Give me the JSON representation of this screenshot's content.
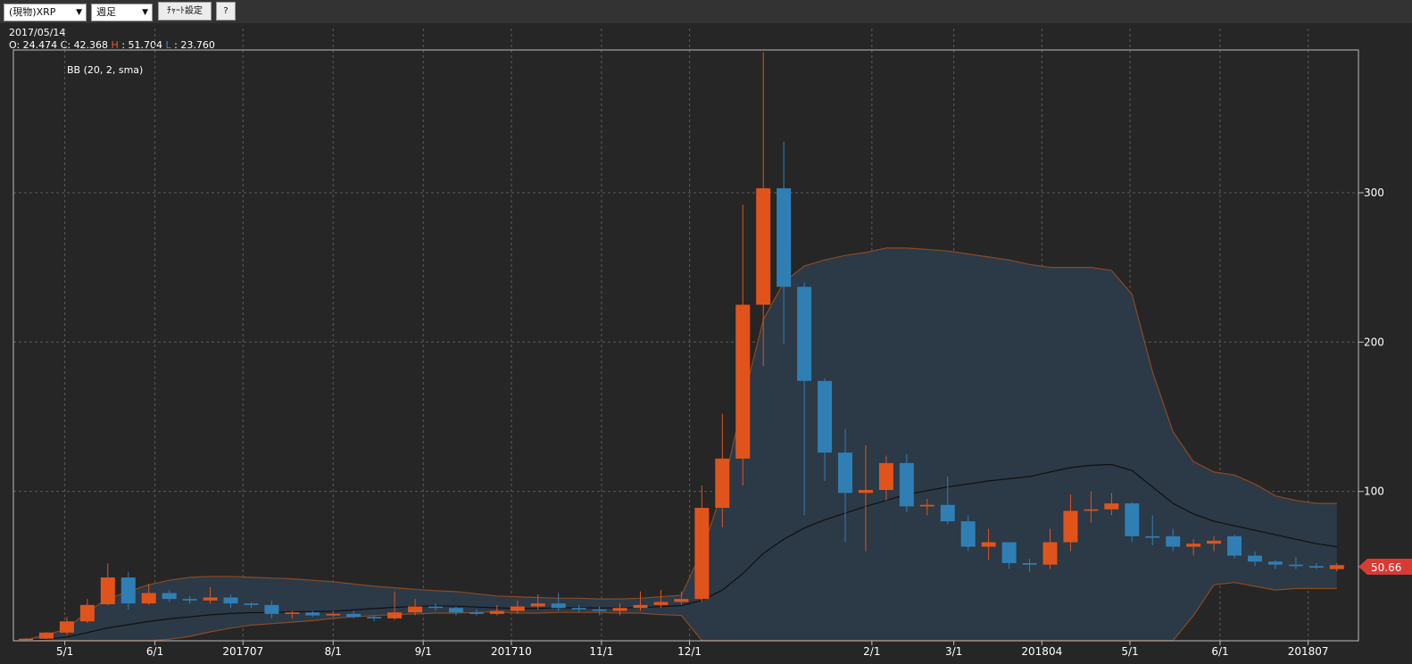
{
  "toolbar": {
    "symbol_select": "(現物)XRP",
    "interval_select": "週足",
    "settings_button": "ﾁｬｰﾄ設定",
    "help_button": "?"
  },
  "info": {
    "date": "2017/05/14",
    "o_label": "O: ",
    "o_value": "24.474",
    "c_label": " C: ",
    "c_value": "42.368",
    "h_label": " H",
    "h_value": " : 51.704",
    "l_label": " L",
    "l_value": " : 23.760"
  },
  "indicator_label": "BB (20, 2, sma)",
  "last_price_label": "50.66",
  "colors": {
    "up": "#e0541c",
    "down": "#2f7fb5",
    "band_fill": "#2c3a48",
    "band_line": "#8a4a22",
    "mid_line": "#111111"
  },
  "chart_data": {
    "type": "candlestick",
    "title": "",
    "xlabel": "",
    "ylabel": "",
    "ylim": [
      0,
      394
    ],
    "grid": true,
    "y_ticks": [
      "100",
      "200",
      "300"
    ],
    "x_ticks": [
      {
        "label": "5/1",
        "week": 1.9
      },
      {
        "label": "6/1",
        "week": 6.3
      },
      {
        "label": "201707",
        "week": 10.6
      },
      {
        "label": "8/1",
        "week": 15.0
      },
      {
        "label": "9/1",
        "week": 19.4
      },
      {
        "label": "201710",
        "week": 23.7
      },
      {
        "label": "11/1",
        "week": 28.1
      },
      {
        "label": "12/1",
        "week": 32.4
      },
      {
        "label": "2/1",
        "week": 41.3
      },
      {
        "label": "3/1",
        "week": 45.3
      },
      {
        "label": "201804",
        "week": 49.6
      },
      {
        "label": "5/1",
        "week": 53.9
      },
      {
        "label": "6/1",
        "week": 58.3
      },
      {
        "label": "201807",
        "week": 62.6
      }
    ],
    "candles": [
      [
        0.6,
        1.4,
        0.2,
        1.8
      ],
      [
        1.4,
        5.5,
        1.2,
        6.0
      ],
      [
        5.5,
        13,
        4,
        16
      ],
      [
        13,
        24,
        12,
        28
      ],
      [
        24.5,
        42.4,
        23.8,
        51.7
      ],
      [
        42.4,
        25,
        21,
        46
      ],
      [
        25,
        32,
        24,
        38
      ],
      [
        32,
        28,
        26,
        34
      ],
      [
        28,
        27,
        25,
        30
      ],
      [
        27,
        29,
        25,
        36
      ],
      [
        29,
        25,
        22,
        31
      ],
      [
        25,
        24,
        22,
        26
      ],
      [
        24,
        18,
        15,
        27
      ],
      [
        18,
        19,
        15,
        20
      ],
      [
        19,
        17,
        16,
        20
      ],
      [
        17,
        18,
        16,
        20
      ],
      [
        18,
        16,
        15,
        20
      ],
      [
        16,
        15,
        13,
        17
      ],
      [
        15,
        19,
        14,
        33
      ],
      [
        19,
        23,
        17,
        28
      ],
      [
        23,
        22,
        20,
        25
      ],
      [
        22,
        19,
        17,
        23
      ],
      [
        19,
        18,
        17,
        21
      ],
      [
        18,
        20,
        17,
        24
      ],
      [
        20,
        23,
        18,
        27
      ],
      [
        23,
        25,
        21,
        31
      ],
      [
        25,
        22,
        20,
        32
      ],
      [
        22,
        21,
        19,
        24
      ],
      [
        21,
        20,
        17,
        23
      ],
      [
        20,
        22,
        17,
        25
      ],
      [
        22,
        24,
        20,
        33
      ],
      [
        24,
        26,
        22,
        34
      ],
      [
        26,
        28,
        24,
        33
      ],
      [
        28,
        89,
        26,
        104
      ],
      [
        89,
        122,
        76,
        152
      ],
      [
        122,
        225,
        104,
        292
      ],
      [
        225,
        303,
        184,
        394
      ],
      [
        303,
        237,
        199,
        334
      ],
      [
        237,
        174,
        84,
        240
      ],
      [
        174,
        126,
        107,
        176
      ],
      [
        126,
        99,
        66,
        142
      ],
      [
        99,
        101,
        60,
        131
      ],
      [
        101,
        119,
        94,
        124
      ],
      [
        119,
        90,
        86,
        125
      ],
      [
        90,
        91,
        84,
        95
      ],
      [
        91,
        80,
        78,
        110
      ],
      [
        80,
        63,
        60,
        84
      ],
      [
        63,
        66,
        54,
        75
      ],
      [
        66,
        52,
        48,
        65
      ],
      [
        52,
        51,
        46,
        55
      ],
      [
        51,
        66,
        48,
        75
      ],
      [
        66,
        87,
        60,
        98
      ],
      [
        87,
        88,
        79,
        100
      ],
      [
        88,
        92,
        84,
        99
      ],
      [
        92,
        70,
        66,
        93
      ],
      [
        70,
        69,
        64,
        84
      ],
      [
        70,
        63,
        60,
        75
      ],
      [
        63,
        65,
        57,
        68
      ],
      [
        65,
        67,
        60,
        70
      ],
      [
        70,
        57,
        55,
        71
      ],
      [
        57,
        53,
        50,
        60
      ],
      [
        53,
        51,
        48,
        54
      ],
      [
        51,
        50,
        48,
        56
      ],
      [
        50,
        49,
        48,
        52
      ],
      [
        48,
        50.66,
        46.5,
        52
      ]
    ],
    "series": [
      {
        "role": "middle",
        "values": [
          0.6,
          1.0,
          2.5,
          5.5,
          8.6,
          10.8,
          12.9,
          14.7,
          16,
          17.4,
          18.3,
          18.8,
          18.9,
          19.3,
          19.5,
          19.7,
          20.7,
          21.6,
          22.4,
          23.0,
          23.4,
          23.2,
          22.6,
          22.1,
          21.5,
          21.7,
          22.1,
          22.1,
          22.0,
          22.0,
          22.2,
          22.9,
          23.6,
          27.0,
          34.0,
          45.0,
          58.5,
          68.0,
          75.5,
          81.0,
          85.5,
          90.0,
          94.0,
          98.0,
          100.5,
          103.0,
          105.0,
          107.0,
          108.5,
          110.0,
          113.0,
          116.0,
          117.5,
          118.0,
          114.0,
          103.0,
          92.0,
          85.0,
          80.0,
          77.0,
          74.0,
          71.0,
          68.0,
          65.0,
          63.0
        ]
      },
      {
        "role": "upper",
        "values": [
          0.6,
          4.0,
          8.0,
          19.5,
          28,
          33,
          37.5,
          40.5,
          42.5,
          43,
          43,
          42.5,
          42,
          41.5,
          40.5,
          39.5,
          38,
          36.5,
          35.5,
          34.5,
          33.5,
          33,
          31.5,
          30,
          29.5,
          29,
          28.5,
          28.5,
          28,
          28,
          28.5,
          29.5,
          30.5,
          60,
          100,
          160,
          215,
          240,
          251,
          255,
          258,
          260,
          263,
          263,
          262,
          261,
          259,
          257,
          255,
          252,
          250,
          250,
          250,
          248,
          232,
          180,
          140,
          120,
          113,
          111,
          105,
          97,
          94,
          92,
          92
        ]
      },
      {
        "role": "lower",
        "values": [
          0.6,
          0.1,
          0.1,
          0.1,
          0.1,
          0.1,
          0.1,
          1.0,
          3.0,
          6.0,
          8.5,
          10.5,
          11.5,
          12.5,
          13.5,
          15.0,
          16.0,
          17.0,
          17.5,
          18.0,
          18.5,
          18.5,
          19.0,
          19.5,
          18.5,
          18.5,
          19.0,
          19.0,
          19.0,
          18.5,
          18.5,
          17.5,
          17.0,
          0.1,
          0.1,
          0.1,
          0.1,
          0.1,
          0.1,
          0.1,
          0.1,
          0.1,
          0.1,
          0.1,
          0.1,
          0.1,
          0.1,
          0.1,
          0.1,
          0.1,
          0.1,
          0.1,
          0.1,
          0.1,
          0.1,
          0.1,
          0.1,
          17.0,
          37.5,
          39,
          36.5,
          34,
          35,
          35,
          35
        ]
      }
    ]
  }
}
